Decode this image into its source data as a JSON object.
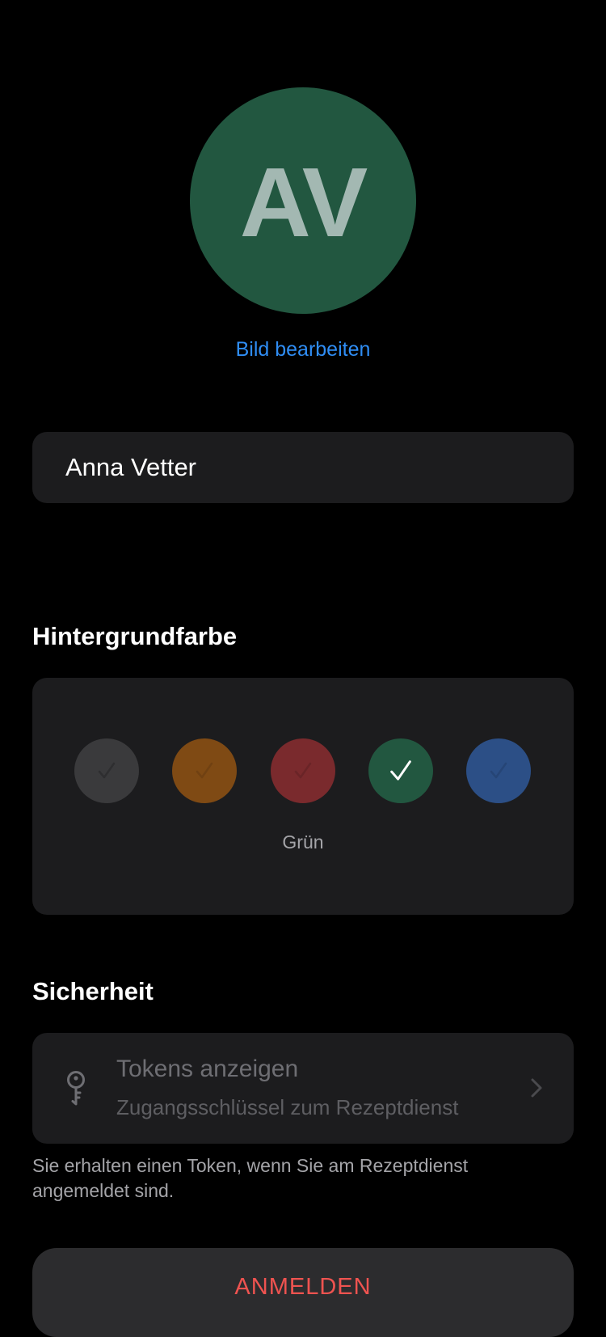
{
  "profile": {
    "initials": "AV",
    "avatar_color": "#225740",
    "edit_image_label": "Bild bearbeiten",
    "name_value": "Anna Vetter"
  },
  "background_color": {
    "title": "Hintergrundfarbe",
    "options": [
      {
        "color": "#3a3a3c",
        "selected": false
      },
      {
        "color": "#7f4a14",
        "selected": false
      },
      {
        "color": "#7a2a2d",
        "selected": false
      },
      {
        "color": "#225740",
        "selected": true
      },
      {
        "color": "#2c4f86",
        "selected": false
      }
    ],
    "selected_label": "Grün"
  },
  "security": {
    "title": "Sicherheit",
    "token_title": "Tokens anzeigen",
    "token_subtitle": "Zugangsschlüssel zum Rezeptdienst",
    "icon": "key-icon",
    "info_text": "Sie erhalten einen Token, wenn Sie am Rezeptdienst angemeldet sind."
  },
  "actions": {
    "login_label": "ANMELDEN",
    "login_color": "#ef5350"
  }
}
